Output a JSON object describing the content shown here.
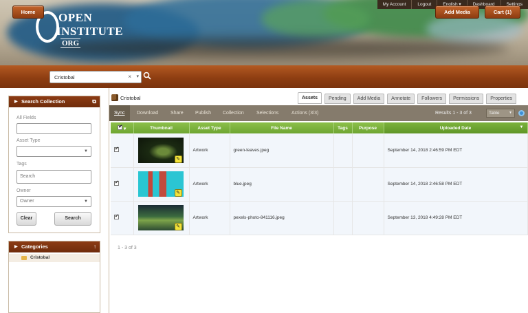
{
  "brand": {
    "logo_line1": "OPEN",
    "logo_line2": "INSTITUTE",
    "logo_line3": "ORG"
  },
  "topnav": [
    "My Account",
    "Logout",
    "English ▾",
    "Dashboard",
    "Settings"
  ],
  "toolbar": {
    "home_label": "Home",
    "search_value": "Cristobal",
    "clear_glyph": "×",
    "dropdown_glyph": "▾",
    "add_media_label": "Add Media",
    "cart_label": "Cart (1)"
  },
  "search_panel": {
    "title": "Search Collection",
    "all_fields_label": "All Fields",
    "all_fields_value": "",
    "asset_type_label": "Asset Type",
    "asset_type_value": "",
    "tags_label": "Tags",
    "tags_placeholder": "Search",
    "owner_label": "Owner",
    "owner_placeholder": "Owner",
    "clear_label": "Clear",
    "search_label": "Search"
  },
  "categories_panel": {
    "title": "Categories",
    "items": [
      "Cristobal"
    ]
  },
  "main": {
    "breadcrumb": "Cristobal",
    "tabs": [
      "Assets",
      "Pending",
      "Add Media",
      "Annotate",
      "Followers",
      "Permissions",
      "Properties"
    ],
    "active_tab": "Assets",
    "actions": [
      "Sync",
      "Download",
      "Share",
      "Publish",
      "Collection",
      "Selections",
      "Actions (3/3)"
    ],
    "active_action": "Sync",
    "results_text": "Results 1 - 3 of 3",
    "view_mode": "Table",
    "columns": [
      "",
      "Thumbnail",
      "Asset Type",
      "File Name",
      "Tags",
      "Purpose",
      "Uploaded Date"
    ],
    "rows": [
      {
        "asset_type": "Artwork",
        "file_name": "green-leaves.jpeg",
        "tags": "",
        "purpose": "",
        "uploaded": "September 14, 2018 2:46:59 PM EDT"
      },
      {
        "asset_type": "Artwork",
        "file_name": "blue.jpeg",
        "tags": "",
        "purpose": "",
        "uploaded": "September 14, 2018 2:46:58 PM EDT"
      },
      {
        "asset_type": "Artwork",
        "file_name": "pexels-photo-841116.jpeg",
        "tags": "",
        "purpose": "",
        "uploaded": "September 13, 2018 4:49:28 PM EDT"
      }
    ],
    "pager_text": "1 - 3 of 3"
  },
  "colors": {
    "wood_accent": "#8e3e12",
    "table_header_green": "#7cb33c",
    "action_bar": "#857b6c"
  }
}
